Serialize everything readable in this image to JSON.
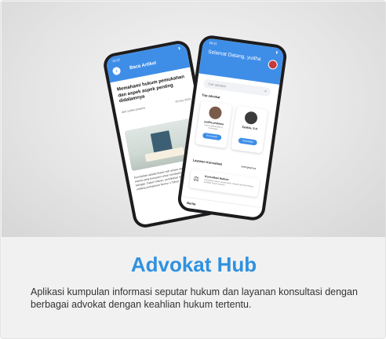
{
  "card": {
    "title": "Advokat Hub",
    "description": "Aplikasi kumpulan informasi seputar hukum dan layanan konsultasi dengan berbagai advokat dengan keahlian hukum tertentu."
  },
  "phone_left": {
    "status_time": "13:22",
    "appbar_title": "Baca Artikel",
    "article_title": "Memahami hukum pemukahan dan aspek aspek penting didalamnya",
    "author": "oleh yudha pratama",
    "date": "09 Nov 2024",
    "back_icon": "arrow-left-icon",
    "body": "Pernikahan adalah ikatan sah antara seorang pria dan wanita yang bertujuan untuk membentuk keluarga bahagia. Dalam hukum, pernikahan diatur dalam undang undang perkawinan Nomor 1 Tahun 1974."
  },
  "phone_right": {
    "status_time": "09:41",
    "greeting": "Selamat Datang, yudha",
    "search_placeholder": "Cari advokat",
    "search_icon": "search-icon",
    "section_top": "Top advokat",
    "advocates": [
      {
        "name": "yudha pratama",
        "specialty": "Hukum perkawinan & Perceraian",
        "button": "Konsultasi"
      },
      {
        "name": "Syakila, S.H",
        "specialty": "-",
        "button": "Konsultasi"
      }
    ],
    "section_services": "Layanan Konsultasi",
    "see_all": "Selengkapnya",
    "service": {
      "title": "Konsultasi Hukum",
      "desc": "Konsultasi hukum secara gratis, dengan advokat dengan keahlian hukum tertentu",
      "icon": "scale-icon"
    },
    "nav_label": "Berita"
  },
  "colors": {
    "accent": "#3e8ee8",
    "title": "#2f91e0"
  }
}
